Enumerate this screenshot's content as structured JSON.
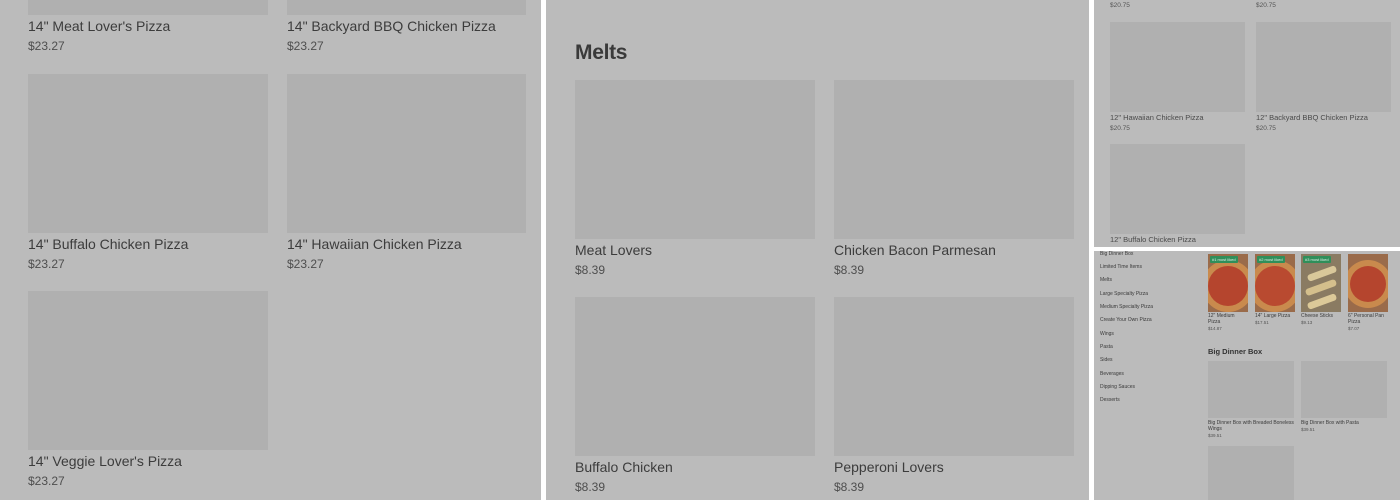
{
  "pane1": {
    "items": [
      {
        "name": "14\" Meat Lover's Pizza",
        "price": "$23.27"
      },
      {
        "name": "14\" Backyard BBQ Chicken Pizza",
        "price": "$23.27"
      },
      {
        "name": "14\" Buffalo Chicken Pizza",
        "price": "$23.27"
      },
      {
        "name": "14\" Hawaiian Chicken Pizza",
        "price": "$23.27"
      },
      {
        "name": "14\" Veggie Lover's Pizza",
        "price": "$23.27"
      }
    ]
  },
  "pane2": {
    "section_title": "Melts",
    "items": [
      {
        "name": "Meat Lovers",
        "price": "$8.39"
      },
      {
        "name": "Chicken Bacon Parmesan",
        "price": "$8.39"
      },
      {
        "name": "Buffalo Chicken",
        "price": "$8.39"
      },
      {
        "name": "Pepperoni Lovers",
        "price": "$8.39"
      }
    ]
  },
  "pane3": {
    "top_prices": [
      "$20.75",
      "$20.75"
    ],
    "items": [
      {
        "name": "12\" Hawaiian Chicken Pizza",
        "price": "$20.75"
      },
      {
        "name": "12\" Backyard BBQ Chicken Pizza",
        "price": "$20.75"
      },
      {
        "name": "12\" Buffalo Chicken Pizza",
        "price": ""
      }
    ]
  },
  "pane4": {
    "nav_items": [
      "Big Dinner Box",
      "Limited Time Items",
      "Melts",
      "Large Specialty Pizza",
      "Medium Specialty Pizza",
      "Create Your Own Pizza",
      "Wings",
      "Pasta",
      "Sides",
      "Beverages",
      "Dipping Sauces",
      "Desserts"
    ],
    "top_items": [
      {
        "badge": "#1 most liked",
        "name": "12\" Medium Pizza",
        "price": "$14.87"
      },
      {
        "badge": "#2 most liked",
        "name": "14\" Large Pizza",
        "price": "$17.51"
      },
      {
        "badge": "#3 most liked",
        "name": "Cheese Sticks",
        "price": "$9.13"
      },
      {
        "badge": "",
        "name": "6\" Personal Pan Pizza",
        "price": "$7.07"
      }
    ],
    "section_title": "Big Dinner Box",
    "box_items": [
      {
        "name": "Big Dinner Box with Breaded Boneless Wings",
        "price": "$39.51"
      },
      {
        "name": "Big Dinner Box with Pasta",
        "price": "$39.51"
      }
    ]
  }
}
